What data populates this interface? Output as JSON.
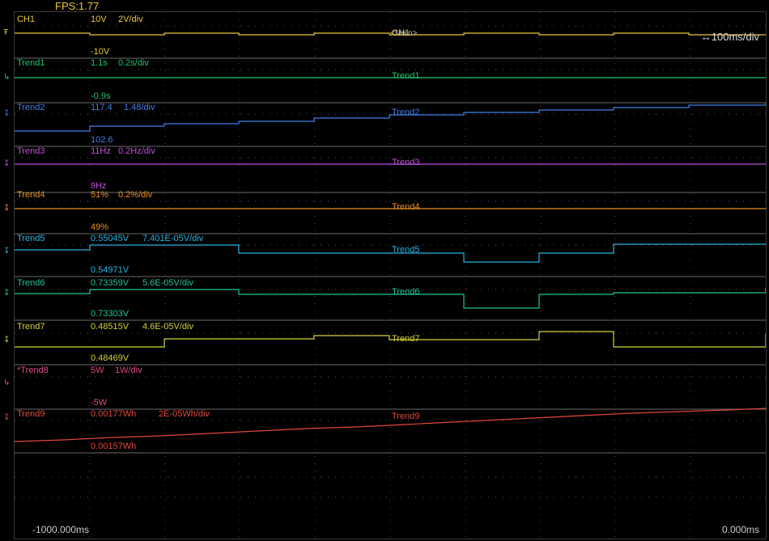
{
  "fps": "FPS:1.77",
  "main_label": "<Main>",
  "time_div": "↔100ms/div",
  "time_start": "-1000.000ms",
  "time_end": "0.000ms",
  "channels": [
    {
      "id": "ch1",
      "label": "CH1",
      "color": "#e8c83a",
      "top": "10V",
      "scale": "2V/div",
      "bottom": "-10V",
      "marker": "Ŧ",
      "trace_label": "CH1"
    },
    {
      "id": "trend1",
      "label": "Trend1",
      "color": "#1fc36b",
      "top": "1.1s",
      "scale": "0.2s/div",
      "bottom": "-0.9s",
      "marker": "↳",
      "trace_label": "Trend1"
    },
    {
      "id": "trend2",
      "label": "Trend2",
      "color": "#3f7fe8",
      "top": "117.4",
      "scale": "1.48/div",
      "bottom": "102.6",
      "marker": "↧",
      "trace_label": "Trend2"
    },
    {
      "id": "trend3",
      "label": "Trend3",
      "color": "#c052d6",
      "top": "11Hz",
      "scale": "0.2Hz/div",
      "bottom": "9Hz",
      "marker": "↧",
      "trace_label": "Trend3"
    },
    {
      "id": "trend4",
      "label": "Trend4",
      "color": "#e8901f",
      "top": "51%",
      "scale": "0.2%/div",
      "bottom": "49%",
      "marker": "↧",
      "trace_label": "Trend4"
    },
    {
      "id": "trend5",
      "label": "Trend5",
      "color": "#29b3e0",
      "top": "0.55045V",
      "scale": "7.401E-05V/div",
      "bottom": "0.54971V",
      "marker": "↧",
      "trace_label": "Trend5"
    },
    {
      "id": "trend6",
      "label": "Trend6",
      "color": "#20c49a",
      "top": "0.73359V",
      "scale": "5.6E-05V/div",
      "bottom": "0.73303V",
      "marker": "↧",
      "trace_label": "Trend6"
    },
    {
      "id": "trend7",
      "label": "Trend7",
      "color": "#d2d23a",
      "top": "0.48515V",
      "scale": "4.6E-05V/div",
      "bottom": "0.48469V",
      "marker": "↧",
      "trace_label": "Trend7"
    },
    {
      "id": "trend8",
      "label": "*Trend8",
      "color": "#e04a8a",
      "top": "5W",
      "scale": "1W/div",
      "bottom": "-5W",
      "marker": "↳",
      "trace_label": ""
    },
    {
      "id": "trend9",
      "label": "Trend9",
      "color": "#e0473a",
      "top": "0.00177Wh",
      "scale": "2E-05Wh/div",
      "bottom": "0.00157Wh",
      "marker": "↧",
      "trace_label": "Trend9"
    }
  ]
}
